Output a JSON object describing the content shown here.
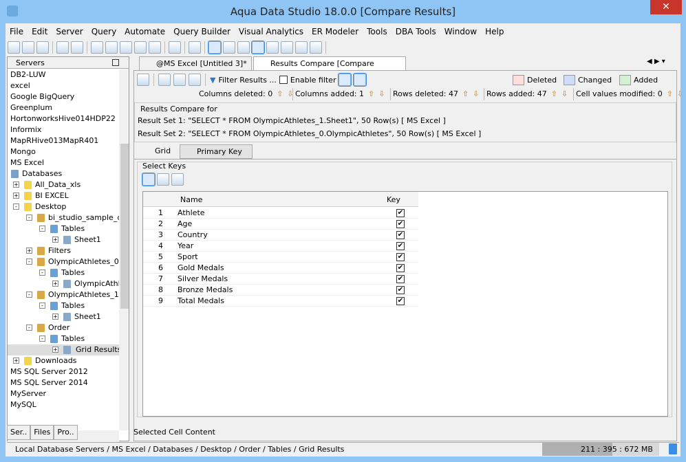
{
  "window": {
    "title": "Aqua Data Studio 18.0.0 [Compare Results]",
    "close": "✕"
  },
  "menu": [
    "File",
    "Edit",
    "Server",
    "Query",
    "Automate",
    "Query Builder",
    "Visual Analytics",
    "ER Modeler",
    "Tools",
    "DBA Tools",
    "Window",
    "Help"
  ],
  "servers": {
    "title": "Servers",
    "items": [
      {
        "label": "DB2-LUW",
        "level": 0
      },
      {
        "label": "excel",
        "level": 0
      },
      {
        "label": "Google BigQuery",
        "level": 0
      },
      {
        "label": "Greenplum",
        "level": 0
      },
      {
        "label": "HortonworksHive014HDP22",
        "level": 0
      },
      {
        "label": "Informix",
        "level": 0
      },
      {
        "label": "MapRHive013MapR401",
        "level": 0
      },
      {
        "label": "Mongo",
        "level": 0
      },
      {
        "label": "MS Excel",
        "level": 0
      },
      {
        "label": "Databases",
        "level": 0,
        "icon": "database"
      },
      {
        "label": "All_Data_xls",
        "level": 1,
        "icon": "folder",
        "exp": "+"
      },
      {
        "label": "BI EXCEL",
        "level": 1,
        "icon": "folder",
        "exp": "+"
      },
      {
        "label": "Desktop",
        "level": 1,
        "icon": "folder",
        "exp": "-"
      },
      {
        "label": "bi_studio_sample_da",
        "level": 2,
        "icon": "schema",
        "exp": "-"
      },
      {
        "label": "Tables",
        "level": 3,
        "icon": "tables",
        "exp": "-"
      },
      {
        "label": "Sheet1",
        "level": 4,
        "icon": "table",
        "exp": "+"
      },
      {
        "label": "Filters",
        "level": 2,
        "icon": "schema",
        "exp": "+"
      },
      {
        "label": "OlympicAthletes_0",
        "level": 2,
        "icon": "schema",
        "exp": "-"
      },
      {
        "label": "Tables",
        "level": 3,
        "icon": "tables",
        "exp": "-"
      },
      {
        "label": "OlympicAthle",
        "level": 4,
        "icon": "table",
        "exp": "+"
      },
      {
        "label": "OlympicAthletes_1",
        "level": 2,
        "icon": "schema",
        "exp": "-"
      },
      {
        "label": "Tables",
        "level": 3,
        "icon": "tables",
        "exp": "-"
      },
      {
        "label": "Sheet1",
        "level": 4,
        "icon": "table",
        "exp": "+"
      },
      {
        "label": "Order",
        "level": 2,
        "icon": "schema",
        "exp": "-"
      },
      {
        "label": "Tables",
        "level": 3,
        "icon": "tables",
        "exp": "-"
      },
      {
        "label": "Grid Results",
        "level": 4,
        "icon": "table",
        "exp": "+",
        "selected": true
      },
      {
        "label": "Downloads",
        "level": 1,
        "icon": "folder",
        "exp": "+"
      },
      {
        "label": "MS SQL Server 2012",
        "level": 0
      },
      {
        "label": "MS SQL Server 2014",
        "level": 0
      },
      {
        "label": "MyServer",
        "level": 0
      },
      {
        "label": "MySQL",
        "level": 0
      }
    ]
  },
  "left_tabs": [
    "Ser..",
    "Files",
    "Pro.."
  ],
  "tabs": [
    {
      "label": "@MS Excel [Untitled 3]*",
      "close": "✕"
    },
    {
      "label": "Results Compare [Compare Results]"
    }
  ],
  "toolbar": {
    "filter": "Filter Results ...",
    "enable_filter": "Enable filter"
  },
  "legend": [
    {
      "label": "Deleted",
      "color": "#fde0dc"
    },
    {
      "label": "Changed",
      "color": "#cfdcf8"
    },
    {
      "label": "Added",
      "color": "#d3f0d3"
    }
  ],
  "stats": [
    "Columns deleted: 0",
    "Columns added: 1",
    "Rows deleted: 47",
    "Rows added: 47",
    "Cell values modified: 0"
  ],
  "compare": {
    "title": "Results Compare for",
    "set1": "Result Set 1: \"SELECT * FROM OlympicAthletes_1.Sheet1\", 50 Row(s)  [ MS Excel ]",
    "set2": "Result Set 2: \"SELECT * FROM OlympicAthletes_0.OlympicAthletes\", 50 Row(s)  [ MS Excel ]"
  },
  "subtabs": [
    "Grid",
    "Primary Key"
  ],
  "keys": {
    "title": "Select Keys",
    "headers": [
      "Name",
      "Key"
    ],
    "rows": [
      {
        "n": "1",
        "name": "Athlete"
      },
      {
        "n": "2",
        "name": "Age"
      },
      {
        "n": "3",
        "name": "Country"
      },
      {
        "n": "4",
        "name": "Year"
      },
      {
        "n": "5",
        "name": "Sport"
      },
      {
        "n": "6",
        "name": "Gold Medals"
      },
      {
        "n": "7",
        "name": "Silver Medals"
      },
      {
        "n": "8",
        "name": "Bronze Medals"
      },
      {
        "n": "9",
        "name": "Total Medals"
      }
    ],
    "check": "✔"
  },
  "selected_cell": "Selected Cell Content",
  "status": {
    "path": "Local Database Servers / MS Excel / Databases / Desktop / Order / Tables / Grid Results",
    "memory": "211 : 395 : 672 MB"
  }
}
